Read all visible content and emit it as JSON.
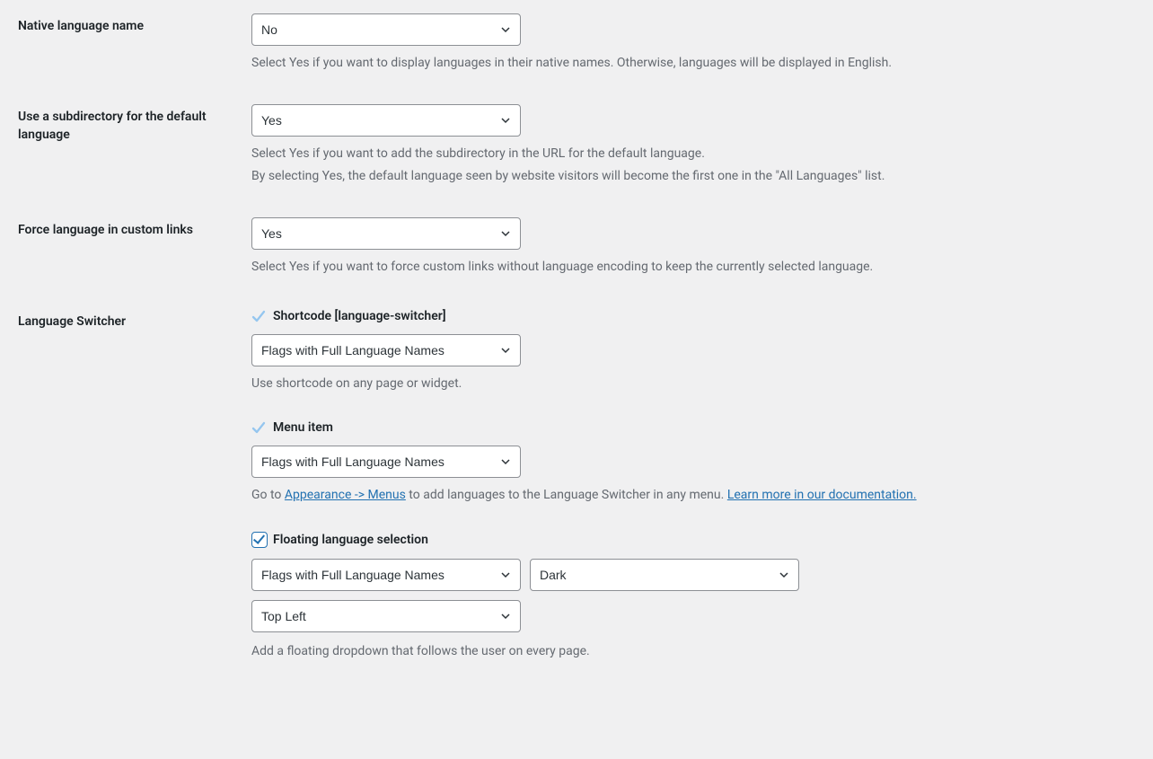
{
  "native_language": {
    "label": "Native language name",
    "value": "No",
    "description": "Select Yes if you want to display languages in their native names. Otherwise, languages will be displayed in English."
  },
  "subdirectory": {
    "label": "Use a subdirectory for the default language",
    "value": "Yes",
    "description1": "Select Yes if you want to add the subdirectory in the URL for the default language.",
    "description2": "By selecting Yes, the default language seen by website visitors will become the first one in the \"All Languages\" list."
  },
  "force_custom": {
    "label": "Force language in custom links",
    "value": "Yes",
    "description": "Select Yes if you want to force custom links without language encoding to keep the currently selected language."
  },
  "language_switcher": {
    "label": "Language Switcher",
    "shortcode": {
      "heading": "Shortcode [language-switcher]",
      "value": "Flags with Full Language Names",
      "description": "Use shortcode on any page or widget."
    },
    "menu": {
      "heading": "Menu item",
      "value": "Flags with Full Language Names",
      "desc_prefix": "Go to ",
      "desc_link1": "Appearance -> Menus",
      "desc_mid": " to add languages to the Language Switcher in any menu. ",
      "desc_link2": "Learn more in our documentation."
    },
    "floating": {
      "heading": "Floating language selection",
      "style_value": "Flags with Full Language Names",
      "theme_value": "Dark",
      "position_value": "Top Left",
      "description": "Add a floating dropdown that follows the user on every page."
    }
  }
}
